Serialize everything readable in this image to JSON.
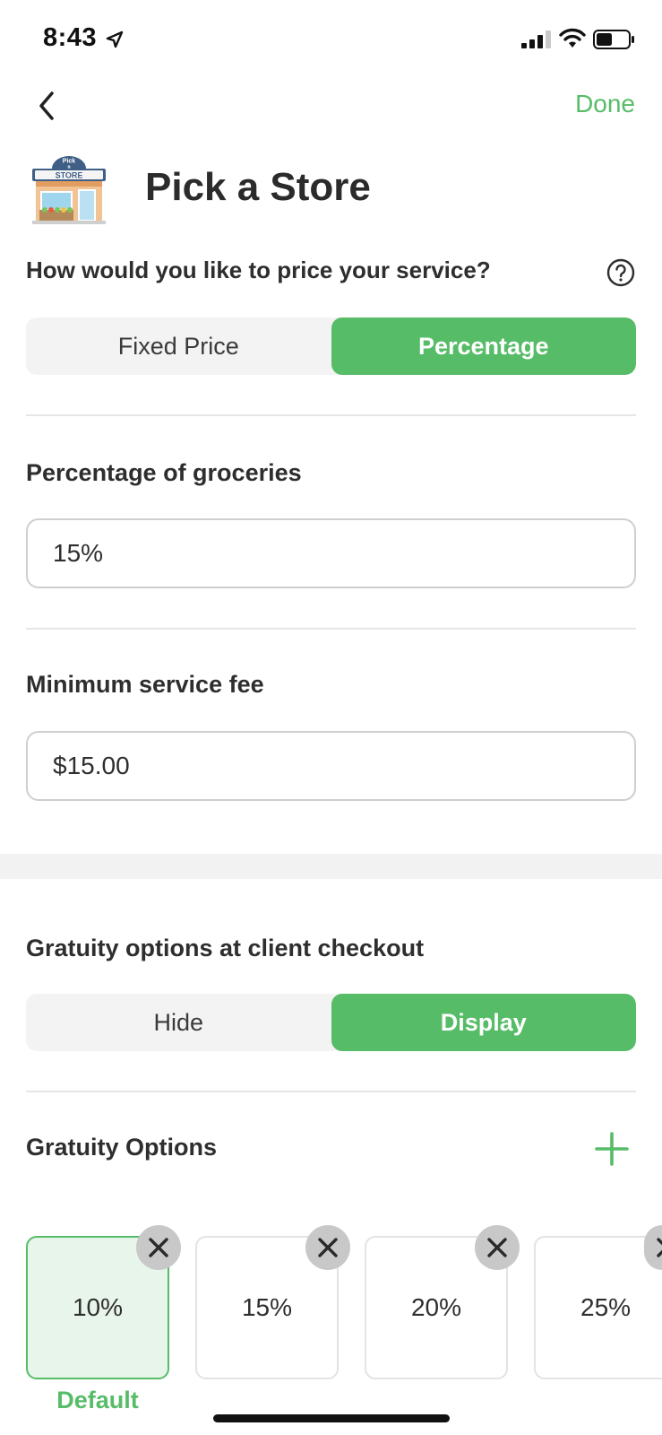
{
  "status_bar": {
    "time": "8:43"
  },
  "nav": {
    "done_label": "Done"
  },
  "header": {
    "title": "Pick a Store",
    "logo_text_top": "Pick",
    "logo_text_mid": "a",
    "logo_text_store": "STORE"
  },
  "pricing": {
    "question": "How would you like to price your service?",
    "options": [
      "Fixed Price",
      "Percentage"
    ],
    "selected": "Percentage"
  },
  "percentage_of_groceries": {
    "label": "Percentage of groceries",
    "value": "15%"
  },
  "minimum_fee": {
    "label": "Minimum service fee",
    "value": "$15.00"
  },
  "gratuity_checkout": {
    "label": "Gratuity options at client checkout",
    "options": [
      "Hide",
      "Display"
    ],
    "selected": "Display"
  },
  "gratuity_options": {
    "label": "Gratuity Options",
    "items": [
      "10%",
      "15%",
      "20%",
      "25%"
    ],
    "default_index": 0,
    "default_label": "Default"
  },
  "colors": {
    "accent": "#57bc67",
    "selected_card_bg": "#e8f5ea"
  }
}
